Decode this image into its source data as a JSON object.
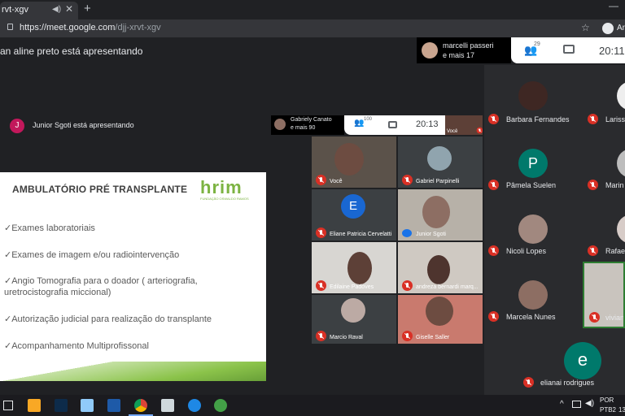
{
  "browser": {
    "tab_title": "rvt-xgv",
    "url_host": "https://meet.google.com",
    "url_path": "/djj-xrvt-xgv",
    "profile_label": "Ar"
  },
  "meet_outer": {
    "presenting_banner": "an aline preto está apresentando",
    "top_chip_name": "marcelli passeri",
    "top_chip_more": "e mais 17",
    "people_count": "29",
    "clock": "20:11"
  },
  "meet_inner": {
    "presenting_banner": "Junior Sgoti está apresentando",
    "presenter_initial": "J",
    "chip_name": "Gabriely Canato",
    "chip_more": "e mais 90",
    "people_count": "100",
    "clock": "20:13",
    "self_label": "Você"
  },
  "slide": {
    "title": "AMBULATÓRIO PRÉ TRANSPLANTE",
    "logo_text": "hrim",
    "logo_sub": "FUNDAÇÃO OSWALDO RAMOS",
    "items": [
      "✓Exames laboratoriais",
      "✓Exames de imagem e/ou radiointervenção",
      "✓Angio Tomografia para o doador ( arteriografia, uretrocistografia miccional)",
      "✓Autorização judicial para realização do transplante",
      "✓Acompanhamento Multiprofissonal"
    ]
  },
  "inner_grid": [
    {
      "name": "Você",
      "initial": ""
    },
    {
      "name": "Gabriel Parpinelli",
      "initial": ""
    },
    {
      "name": "Eliane Patricia Cervelatti",
      "initial": "E"
    },
    {
      "name": "Junior Sgoti",
      "initial": ""
    },
    {
      "name": "Edilaine Padoves",
      "initial": ""
    },
    {
      "name": "andreza bernardi marq...",
      "initial": ""
    },
    {
      "name": "Marcio Raval",
      "initial": ""
    },
    {
      "name": "Giselle Saller",
      "initial": ""
    }
  ],
  "participants": [
    {
      "name": "Barbara Fernandes",
      "initial": ""
    },
    {
      "name": "Lariss",
      "initial": ""
    },
    {
      "name": "Pâmela Suelen",
      "initial": "P"
    },
    {
      "name": "Marin",
      "initial": ""
    },
    {
      "name": "Nicoli Lopes",
      "initial": ""
    },
    {
      "name": "Rafae",
      "initial": ""
    },
    {
      "name": "Marcela Nunes",
      "initial": ""
    },
    {
      "name": "vivian",
      "initial": ""
    },
    {
      "name": "elianai rodrigues",
      "initial": "e"
    }
  ],
  "taskbar": {
    "lang_top": "POR",
    "lang_bottom": "PTB2",
    "time_partial": "13"
  },
  "colors": {
    "meet_bg": "#202124",
    "mute_red": "#d93025",
    "avatar_blue": "#1967d2",
    "avatar_teal": "#00796b",
    "logo_green": "#7cb342"
  }
}
